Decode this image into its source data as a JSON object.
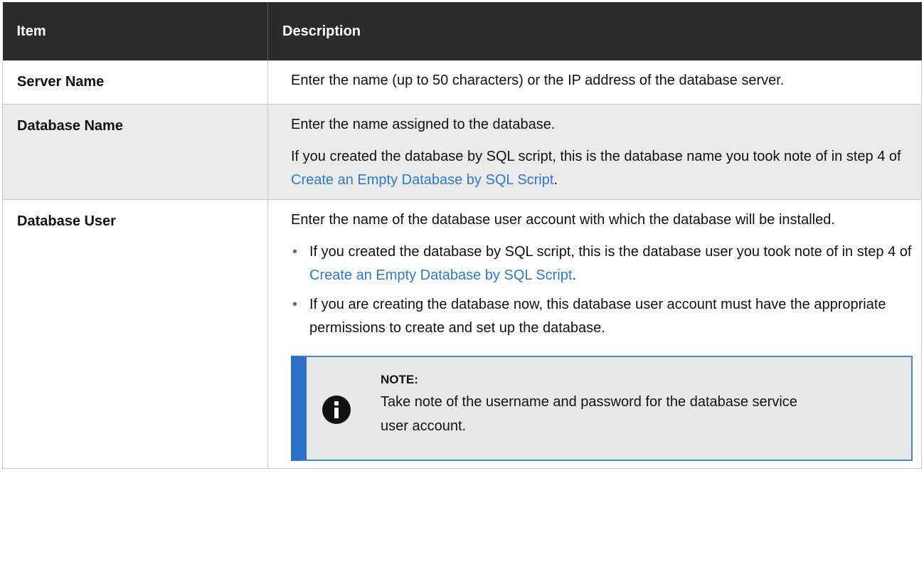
{
  "table": {
    "headers": {
      "item": "Item",
      "description": "Description"
    },
    "rows": [
      {
        "item": "Server Name",
        "description": "Enter the name (up to 50 characters) or the IP address of the database server."
      },
      {
        "item": "Database Name",
        "p1": "Enter the name assigned to the database.",
        "p2_prefix": "If you created the database by SQL script, this is the database name you took note of in step 4 of ",
        "p2_link": "Create an Empty Database by SQL Script",
        "p2_suffix": "."
      },
      {
        "item": "Database User",
        "p1": "Enter the name of the database user account with which the database will be installed.",
        "bullets": [
          {
            "prefix": "If you created the database by SQL script, this is the database user you took note of in step 4 of ",
            "link": "Create an Empty Database by SQL Script",
            "suffix": "."
          },
          {
            "text": "If you are creating the database now, this database user account must have the appropriate permissions to create and set up the database."
          }
        ],
        "note": {
          "icon": "info-icon",
          "title": "NOTE:",
          "text": "Take note of the username and password for the database service user account."
        }
      }
    ]
  },
  "colors": {
    "header_bg": "#2b2b2b",
    "row_alt_bg": "#ebebeb",
    "link": "#2a7ad6",
    "note_accent": "#2a72c9"
  }
}
